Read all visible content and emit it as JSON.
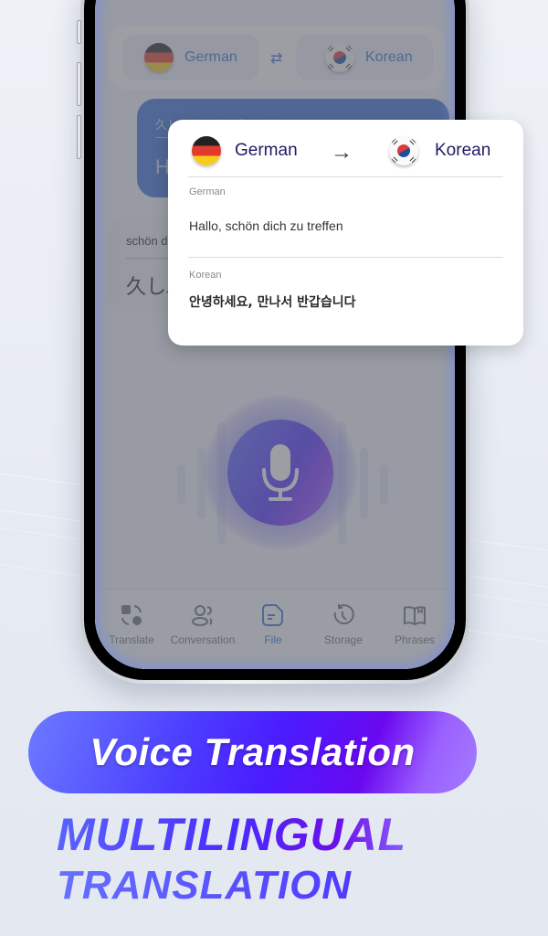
{
  "language_bar": {
    "source": {
      "label": "German",
      "flag": "germany-flag"
    },
    "target": {
      "label": "Korean",
      "flag": "south-korea-flag"
    },
    "swap_icon": "swap-arrows-icon"
  },
  "conversation": {
    "blue_bubble": {
      "line1": "久しぶり！お元気ですか",
      "line2": "Ha"
    },
    "grey_bubble": {
      "line1": "schön d",
      "line2": "久しぶ"
    }
  },
  "mic_button": {
    "icon": "microphone-icon"
  },
  "tabs": [
    {
      "label": "Translate",
      "icon": "translate-icon",
      "active": false
    },
    {
      "label": "Conversation",
      "icon": "conversation-icon",
      "active": false
    },
    {
      "label": "File",
      "icon": "file-icon",
      "active": true
    },
    {
      "label": "Storage",
      "icon": "history-icon",
      "active": false
    },
    {
      "label": "Phrases",
      "icon": "book-icon",
      "active": false
    }
  ],
  "popup": {
    "from_label": "German",
    "to_label": "Korean",
    "arrow": "→",
    "source_lang": "German",
    "source_text": "Hallo, schön dich zu treffen",
    "target_lang": "Korean",
    "target_text": "안녕하세요, 만나서 반갑습니다"
  },
  "promo": {
    "pill_text": "Voice Translation",
    "headline_line1": "MULTILINGUAL",
    "headline_line2": "TRANSLATION"
  },
  "colors": {
    "accent_blue": "#3b6fd6",
    "brand_purple": "#4a2cff",
    "popup_title": "#1d1b63"
  }
}
